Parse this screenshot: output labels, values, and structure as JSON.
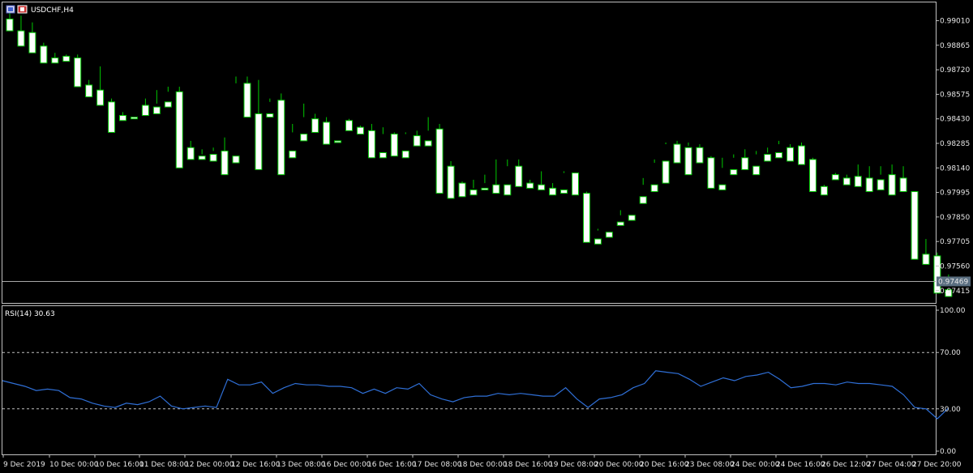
{
  "window": {
    "symbol_title": "USDCHF,H4",
    "indicator_title": "RSI(14) 30.63"
  },
  "colors": {
    "background": "#000000",
    "frame": "#c0c0c0",
    "bull_body": "#000000",
    "bear_body": "#ffffff",
    "candle_outline": "#00c800",
    "rsi_line": "#2f6fd6",
    "level_line": "#c0c0c0",
    "bid_line": "#a8a8a8",
    "bid_label_bg": "#5a6e80"
  },
  "chart_data": [
    {
      "type": "candlestick",
      "title": "USDCHF,H4",
      "ylim": [
        0.97342,
        0.99118
      ],
      "ytick_labels": [
        "0.99010",
        "0.98865",
        "0.98720",
        "0.98575",
        "0.98430",
        "0.98285",
        "0.98140",
        "0.97995",
        "0.97850",
        "0.97705",
        "0.97560",
        "0.97415"
      ],
      "current_price_label": "0.97469",
      "current_price": 0.97469,
      "x_labels": [
        "9 Dec 2019",
        "10 Dec 00:00",
        "10 Dec 16:00",
        "11 Dec 08:00",
        "12 Dec 00:00",
        "12 Dec 16:00",
        "13 Dec 08:00",
        "16 Dec 00:00",
        "16 Dec 16:00",
        "17 Dec 08:00",
        "18 Dec 00:00",
        "18 Dec 16:00",
        "19 Dec 08:00",
        "20 Dec 00:00",
        "20 Dec 16:00",
        "23 Dec 08:00",
        "24 Dec 00:00",
        "24 Dec 16:00",
        "26 Dec 12:00",
        "27 Dec 04:00",
        "27 Dec 20:00"
      ],
      "ohlc": [
        [
          0.9902,
          0.991,
          0.9897,
          0.9895
        ],
        [
          0.9895,
          0.9904,
          0.9893,
          0.9886
        ],
        [
          0.9894,
          0.99,
          0.9892,
          0.9882
        ],
        [
          0.9886,
          0.9888,
          0.9878,
          0.9876
        ],
        [
          0.9879,
          0.9882,
          0.9877,
          0.9876
        ],
        [
          0.988,
          0.9881,
          0.9878,
          0.9877
        ],
        [
          0.9879,
          0.9881,
          0.9863,
          0.9862
        ],
        [
          0.9863,
          0.9866,
          0.986,
          0.9856
        ],
        [
          0.986,
          0.9874,
          0.9852,
          0.9851
        ],
        [
          0.9853,
          0.9855,
          0.9846,
          0.9835
        ],
        [
          0.9845,
          0.9847,
          0.9844,
          0.9842
        ],
        [
          0.9844,
          0.9853,
          0.9853,
          0.9843
        ],
        [
          0.9851,
          0.9855,
          0.9849,
          0.9845
        ],
        [
          0.985,
          0.986,
          0.9852,
          0.9846
        ],
        [
          0.9853,
          0.9862,
          0.9859,
          0.985
        ],
        [
          0.9859,
          0.9862,
          0.9825,
          0.9814
        ],
        [
          0.9826,
          0.983,
          0.982,
          0.9819
        ],
        [
          0.9821,
          0.9825,
          0.9822,
          0.9819
        ],
        [
          0.9822,
          0.9826,
          0.9824,
          0.9818
        ],
        [
          0.9824,
          0.9832,
          0.982,
          0.981
        ],
        [
          0.9821,
          0.9868,
          0.9864,
          0.9817
        ],
        [
          0.9864,
          0.9868,
          0.9845,
          0.9844
        ],
        [
          0.9846,
          0.9866,
          0.9846,
          0.9813
        ],
        [
          0.9846,
          0.9855,
          0.9853,
          0.9844
        ],
        [
          0.9854,
          0.9858,
          0.9824,
          0.981
        ],
        [
          0.9824,
          0.984,
          0.9835,
          0.982
        ],
        [
          0.9834,
          0.9852,
          0.9844,
          0.983
        ],
        [
          0.9843,
          0.9846,
          0.9841,
          0.9835
        ],
        [
          0.9841,
          0.9844,
          0.9829,
          0.9828
        ],
        [
          0.983,
          0.9842,
          0.9842,
          0.9829
        ],
        [
          0.9842,
          0.9843,
          0.9839,
          0.9836
        ],
        [
          0.9838,
          0.9839,
          0.9836,
          0.9834
        ],
        [
          0.9836,
          0.984,
          0.9823,
          0.982
        ],
        [
          0.9823,
          0.9838,
          0.9834,
          0.982
        ],
        [
          0.9834,
          0.9835,
          0.9823,
          0.9821
        ],
        [
          0.9824,
          0.9835,
          0.9834,
          0.982
        ],
        [
          0.9833,
          0.9836,
          0.9831,
          0.9827
        ],
        [
          0.983,
          0.9844,
          0.9836,
          0.9827
        ],
        [
          0.9837,
          0.984,
          0.9816,
          0.9799
        ],
        [
          0.9815,
          0.9818,
          0.9805,
          0.9796
        ],
        [
          0.9805,
          0.9806,
          0.9801,
          0.9797
        ],
        [
          0.9801,
          0.9807,
          0.9802,
          0.9798
        ],
        [
          0.9802,
          0.981,
          0.9805,
          0.9801
        ],
        [
          0.9804,
          0.9819,
          0.9804,
          0.9799
        ],
        [
          0.9804,
          0.9819,
          0.9815,
          0.9798
        ],
        [
          0.9815,
          0.9819,
          0.9806,
          0.9803
        ],
        [
          0.9805,
          0.9807,
          0.9804,
          0.9802
        ],
        [
          0.9804,
          0.9812,
          0.9802,
          0.9801
        ],
        [
          0.9802,
          0.9805,
          0.9801,
          0.9798
        ],
        [
          0.9801,
          0.9812,
          0.9811,
          0.9799
        ],
        [
          0.9811,
          0.9811,
          0.98,
          0.9798
        ],
        [
          0.9799,
          0.98,
          0.9772,
          0.977
        ],
        [
          0.9772,
          0.9778,
          0.9777,
          0.9769
        ],
        [
          0.9776,
          0.9782,
          0.9782,
          0.9773
        ],
        [
          0.9782,
          0.9789,
          0.9786,
          0.978
        ],
        [
          0.9786,
          0.9797,
          0.9797,
          0.9783
        ],
        [
          0.9797,
          0.9808,
          0.9804,
          0.9793
        ],
        [
          0.9804,
          0.9819,
          0.9817,
          0.98
        ],
        [
          0.9818,
          0.9829,
          0.9828,
          0.9805
        ],
        [
          0.9828,
          0.983,
          0.9824,
          0.9817
        ],
        [
          0.9826,
          0.9829,
          0.9827,
          0.981
        ],
        [
          0.9826,
          0.9828,
          0.982,
          0.9817
        ],
        [
          0.982,
          0.9821,
          0.9803,
          0.9802
        ],
        [
          0.9804,
          0.982,
          0.9814,
          0.9801
        ],
        [
          0.9813,
          0.9822,
          0.982,
          0.981
        ],
        [
          0.982,
          0.9825,
          0.9814,
          0.9813
        ],
        [
          0.9815,
          0.9824,
          0.9822,
          0.981
        ],
        [
          0.9822,
          0.9826,
          0.9823,
          0.9818
        ],
        [
          0.9823,
          0.983,
          0.9828,
          0.982
        ],
        [
          0.9826,
          0.9828,
          0.9821,
          0.9818
        ],
        [
          0.9827,
          0.9829,
          0.9818,
          0.9816
        ],
        [
          0.9819,
          0.982,
          0.9801,
          0.98
        ],
        [
          0.9803,
          0.9804,
          0.98,
          0.9798
        ],
        [
          0.981,
          0.9811,
          0.9808,
          0.9807
        ],
        [
          0.9808,
          0.981,
          0.9807,
          0.9804
        ],
        [
          0.9809,
          0.9816,
          0.9808,
          0.9803
        ],
        [
          0.9808,
          0.9815,
          0.9804,
          0.98
        ],
        [
          0.9807,
          0.9815,
          0.981,
          0.9801
        ],
        [
          0.981,
          0.9816,
          0.9806,
          0.9798
        ],
        [
          0.9808,
          0.9815,
          0.9803,
          0.98
        ],
        [
          0.98,
          0.98,
          0.9763,
          0.976
        ],
        [
          0.9763,
          0.9772,
          0.9761,
          0.9757
        ],
        [
          0.9762,
          0.9764,
          0.9742,
          0.974
        ],
        [
          0.9742,
          0.9751,
          0.9747,
          0.9738
        ]
      ]
    },
    {
      "type": "line",
      "title": "RSI(14) 30.63",
      "ylim": [
        0,
        100
      ],
      "ytick_labels": [
        "100.00",
        "70.00",
        "30.00",
        "0.00"
      ],
      "levels": [
        70,
        30
      ],
      "values": [
        50,
        48,
        46,
        43,
        44,
        43,
        38,
        37,
        34,
        32,
        31,
        34,
        33,
        35,
        39,
        32,
        30,
        31,
        32,
        31,
        51,
        47,
        47,
        49,
        41,
        45,
        48,
        47,
        47,
        46,
        46,
        45,
        41,
        44,
        41,
        45,
        44,
        48,
        40,
        37,
        35,
        38,
        39,
        39,
        41,
        40,
        41,
        40,
        39,
        39,
        45,
        37,
        31,
        37,
        38,
        40,
        45,
        48,
        57,
        56,
        55,
        51,
        46,
        49,
        52,
        50,
        53,
        54,
        56,
        51,
        45,
        46,
        48,
        48,
        47,
        49,
        48,
        48,
        47,
        46,
        40,
        31,
        30,
        23,
        30.63
      ]
    }
  ]
}
